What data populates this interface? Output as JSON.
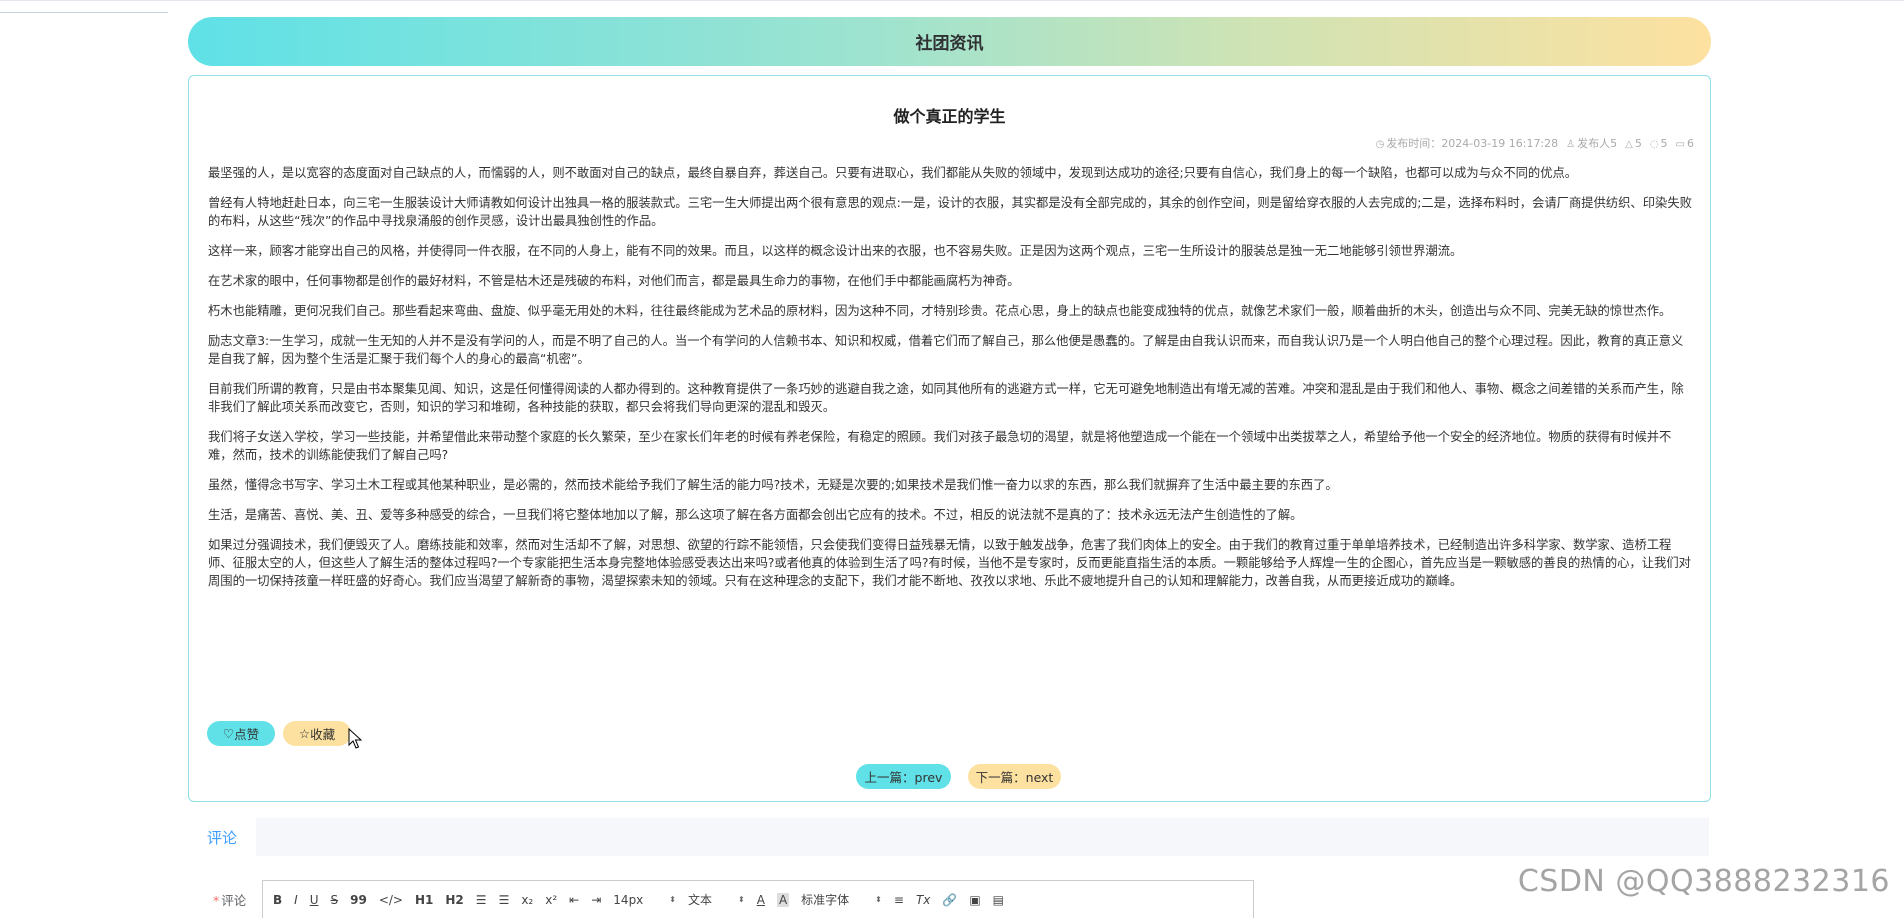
{
  "banner": {
    "title": "社团资讯"
  },
  "article": {
    "title": "做个真正的学生",
    "meta": {
      "publish_label": "发布时间：",
      "publish_time": "2024-03-19 16:17:28",
      "author_label": "发布人",
      "author_value": "5",
      "likes": "5",
      "views": "5",
      "favorites": "6"
    },
    "paragraphs": [
      "最坚强的人，是以宽容的态度面对自己缺点的人，而懦弱的人，则不敢面对自己的缺点，最终自暴自弃，葬送自己。只要有进取心，我们都能从失败的领域中，发现到达成功的途径;只要有自信心，我们身上的每一个缺陷，也都可以成为与众不同的优点。",
      "曾经有人特地赶赴日本，向三宅一生服装设计大师请教如何设计出独具一格的服装款式。三宅一生大师提出两个很有意思的观点:一是，设计的衣服，其实都是没有全部完成的，其余的创作空间，则是留给穿衣服的人去完成的;二是，选择布料时，会请厂商提供纺织、印染失败的布料，从这些“残次”的作品中寻找泉涌般的创作灵感，设计出最具独创性的作品。",
      "这样一来，顾客才能穿出自己的风格，并使得同一件衣服，在不同的人身上，能有不同的效果。而且，以这样的概念设计出来的衣服，也不容易失败。正是因为这两个观点，三宅一生所设计的服装总是独一无二地能够引领世界潮流。",
      "在艺术家的眼中，任何事物都是创作的最好材料，不管是枯木还是残破的布料，对他们而言，都是最具生命力的事物，在他们手中都能画腐朽为神奇。",
      "朽木也能精雕，更何况我们自己。那些看起来弯曲、盘旋、似乎毫无用处的木料，往往最终能成为艺术品的原材料，因为这种不同，才特别珍贵。花点心思，身上的缺点也能变成独特的优点，就像艺术家们一般，顺着曲折的木头，创造出与众不同、完美无缺的惊世杰作。",
      "励志文章3:一生学习，成就一生无知的人并不是没有学问的人，而是不明了自己的人。当一个有学问的人信赖书本、知识和权威，借着它们而了解自己，那么他便是愚蠢的。了解是由自我认识而来，而自我认识乃是一个人明白他自己的整个心理过程。因此，教育的真正意义是自我了解，因为整个生活是汇聚于我们每个人的身心的最高“机密”。",
      "目前我们所谓的教育，只是由书本聚集见闻、知识，这是任何懂得阅读的人都办得到的。这种教育提供了一条巧妙的逃避自我之途，如同其他所有的逃避方式一样，它无可避免地制造出有增无减的苦难。冲突和混乱是由于我们和他人、事物、概念之间差错的关系而产生，除非我们了解此项关系而改变它，否则，知识的学习和堆砌，各种技能的获取，都只会将我们导向更深的混乱和毁灭。",
      "我们将子女送入学校，学习一些技能，并希望借此来带动整个家庭的长久繁荣，至少在家长们年老的时候有养老保险，有稳定的照顾。我们对孩子最急切的渴望，就是将他塑造成一个能在一个领域中出类拔萃之人，希望给予他一个安全的经济地位。物质的获得有时候并不难，然而，技术的训练能使我们了解自己吗?",
      "虽然，懂得念书写字、学习土木工程或其他某种职业，是必需的，然而技术能给予我们了解生活的能力吗?技术，无疑是次要的;如果技术是我们惟一奋力以求的东西，那么我们就摒弃了生活中最主要的东西了。",
      "生活，是痛苦、喜悦、美、丑、爱等多种感受的综合，一旦我们将它整体地加以了解，那么这项了解在各方面都会创出它应有的技术。不过，相反的说法就不是真的了：技术永远无法产生创造性的了解。",
      "如果过分强调技术，我们便毁灭了人。磨练技能和效率，然而对生活却不了解，对思想、欲望的行踪不能领悟，只会使我们变得日益残暴无情，以致于触发战争，危害了我们肉体上的安全。由于我们的教育过重于单单培养技术，已经制造出许多科学家、数学家、造桥工程师、征服太空的人，但这些人了解生活的整体过程吗?一个专家能把生活本身完整地体验感受表达出来吗?或者他真的体验到生活了吗?有时候，当他不是专家时，反而更能直指生活的本质。一颗能够给予人辉煌一生的企图心，首先应当是一颗敏感的善良的热情的心，让我们对周围的一切保持孩童一样旺盛的好奇心。我们应当渴望了解新奇的事物，渴望探索未知的领域。只有在这种理念的支配下，我们才能不断地、孜孜以求地、乐此不疲地提升自己的认知和理解能力，改善自我，从而更接近成功的巅峰。"
    ]
  },
  "actions": {
    "like_label": "点赞",
    "favorite_label": "收藏",
    "prev_label": "上一篇：prev",
    "next_label": "下一篇：next"
  },
  "tabs": {
    "comment_tab": "评论"
  },
  "comment": {
    "label": "评论",
    "toolbar": {
      "bold": "B",
      "italic": "I",
      "underline": "U",
      "strike": "S",
      "blockquote": "99",
      "code": "</>",
      "h1": "H1",
      "h2": "H2",
      "ordered_list": "☰",
      "bullet_list": "☰",
      "subscript": "x₂",
      "superscript": "x²",
      "outdent": "⇤",
      "indent": "⇥",
      "size": "14px",
      "type": "文本",
      "font_color": "A",
      "bg_color": "A",
      "font": "标准字体",
      "align": "≡",
      "clean": "Tx",
      "link": "🔗",
      "image": "▣",
      "video": "▤"
    }
  },
  "watermark": "CSDN @QQ3888232316",
  "colors": {
    "cyan": "#5fe1e7",
    "sand": "#fde1a0",
    "link_blue": "#409eff"
  }
}
